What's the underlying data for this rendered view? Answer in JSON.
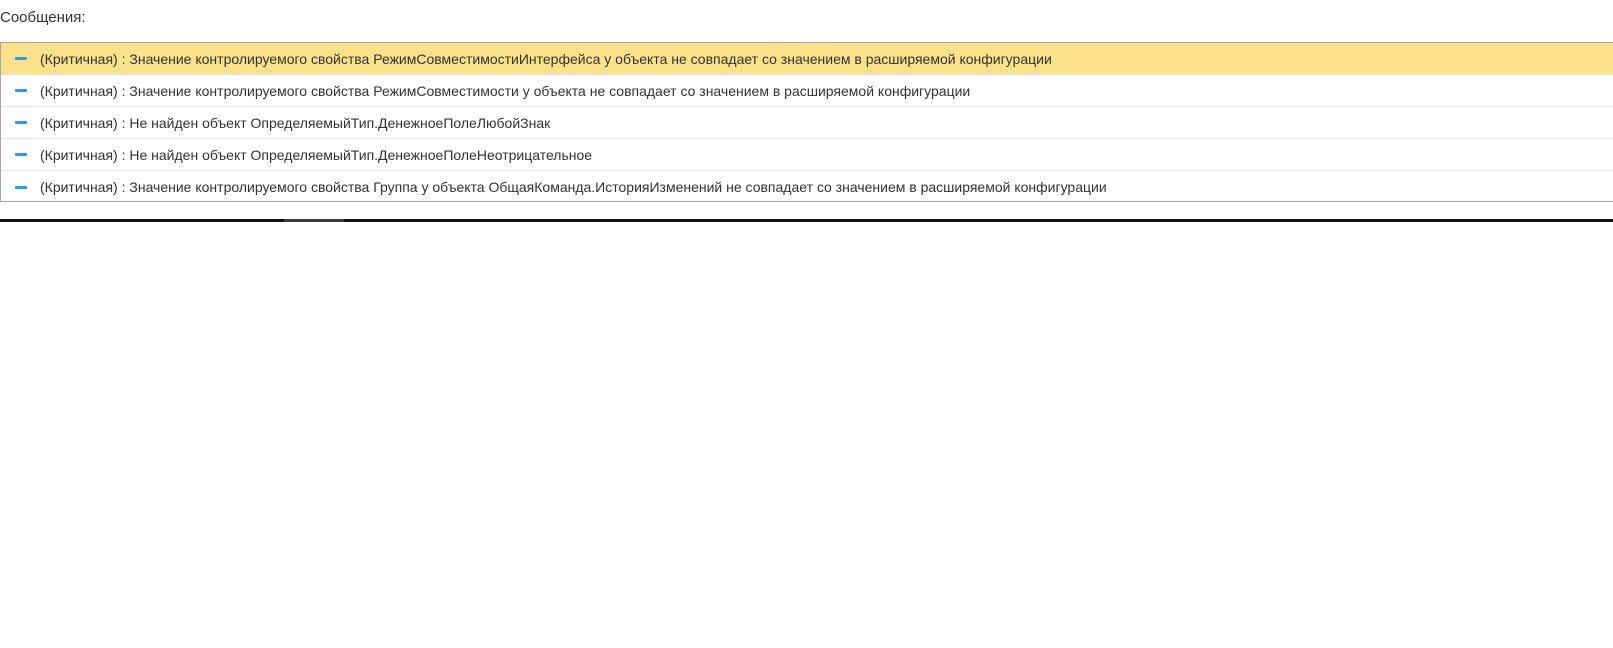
{
  "panel": {
    "title": "Сообщения:"
  },
  "messages": [
    {
      "text": "(Критичная) : Значение контролируемого свойства РежимСовместимостиИнтерфейса у объекта  не совпадает со значением в расширяемой конфигурации",
      "selected": true
    },
    {
      "text": "(Критичная) : Значение контролируемого свойства РежимСовместимости у объекта  не совпадает со значением в расширяемой конфигурации",
      "selected": false
    },
    {
      "text": "(Критичная) : Не найден объект ОпределяемыйТип.ДенежноеПолеЛюбойЗнак",
      "selected": false
    },
    {
      "text": "(Критичная) : Не найден объект ОпределяемыйТип.ДенежноеПолеНеотрицательное",
      "selected": false
    },
    {
      "text": "(Критичная) : Значение контролируемого свойства Группа у объекта ОбщаяКоманда.ИсторияИзменений не совпадает со значением в расширяемой конфигурации",
      "selected": false
    }
  ],
  "colors": {
    "selected_row": "#fbe18a",
    "dash_icon": "#2a9fd8",
    "border": "#a9a9a9"
  },
  "icons": {
    "row_marker": "dash-icon"
  }
}
